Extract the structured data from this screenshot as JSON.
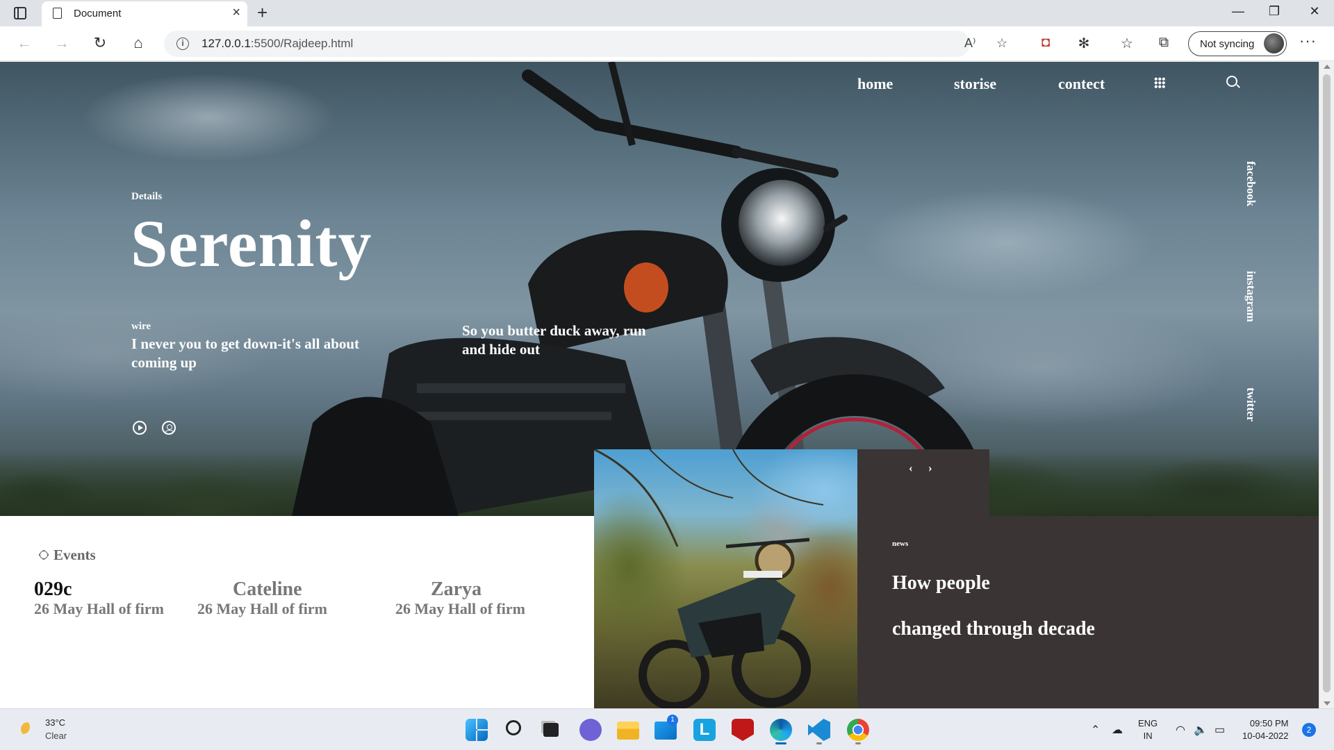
{
  "browser": {
    "tab_title": "Document",
    "url_host": "127.0.0.1",
    "url_rest": ":5500/Rajdeep.html",
    "sync_label": "Not syncing"
  },
  "nav": {
    "links": [
      "home",
      "storise",
      "contect"
    ]
  },
  "social": [
    "facebook",
    "instagram",
    "twitter"
  ],
  "hero": {
    "kicker": "Details",
    "title": "Serenity",
    "wire_label": "wire",
    "quote": "I never you to get down-it's all about coming up",
    "quote2": "So you butter duck away, run and hide out"
  },
  "events": {
    "heading": "Events",
    "items": [
      {
        "name": "029c",
        "sub": "26 May Hall of firm",
        "color": "#111111"
      },
      {
        "name": "Cateline",
        "sub": "26 May Hall of firm",
        "color": "#777777"
      },
      {
        "name": "Zarya",
        "sub": "26 May Hall of firm",
        "color": "#777777"
      }
    ]
  },
  "news": {
    "label": "news",
    "headline_1": "How people",
    "headline_2": "changed through decade",
    "prev": "‹",
    "next": "›"
  },
  "taskbar": {
    "temp": "33°C",
    "condition": "Clear",
    "lang_1": "ENG",
    "lang_2": "IN",
    "time": "09:50 PM",
    "date": "10-04-2022",
    "notifications": "2",
    "mail_badge": "1",
    "apps": [
      "windows-start",
      "search",
      "task-view",
      "teams-chat",
      "file-explorer",
      "mail",
      "lexicon",
      "mcafee",
      "edge",
      "vscode",
      "chrome"
    ]
  },
  "colors": {
    "news_bg": "#3a3434",
    "accent": "#1a73e8"
  }
}
